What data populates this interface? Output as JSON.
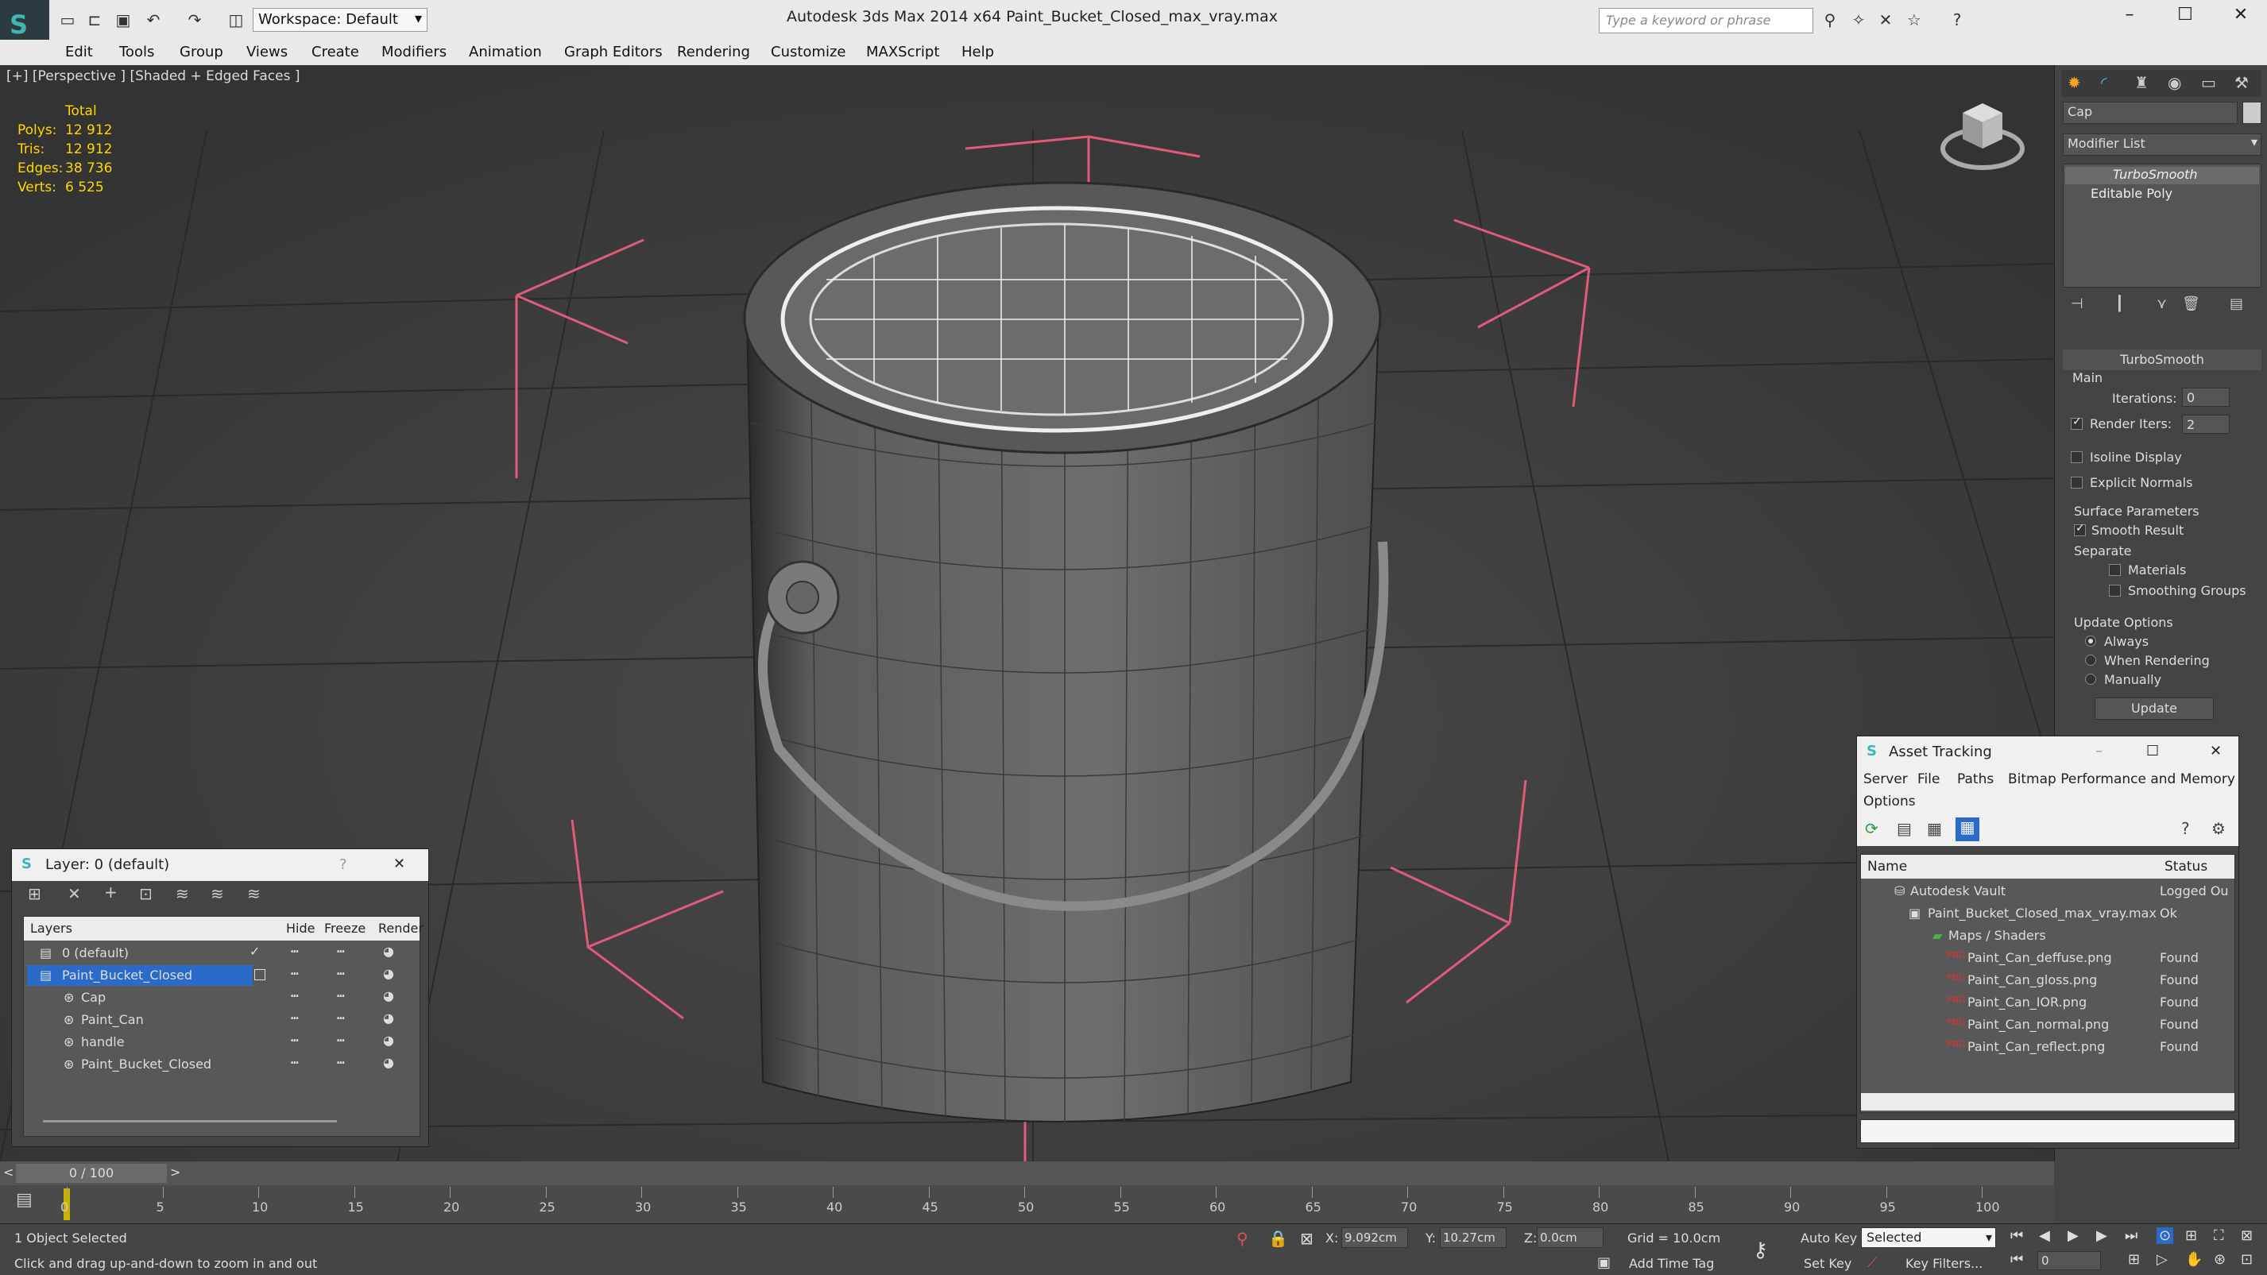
{
  "titlebar": {
    "workspace": "Workspace: Default",
    "title": "Autodesk 3ds Max  2014 x64      Paint_Bucket_Closed_max_vray.max",
    "search_placeholder": "Type a keyword or phrase"
  },
  "menu": [
    "Edit",
    "Tools",
    "Group",
    "Views",
    "Create",
    "Modifiers",
    "Animation",
    "Graph Editors",
    "Rendering",
    "Customize",
    "MAXScript",
    "Help"
  ],
  "viewport": {
    "label": "[+] [Perspective ] [Shaded + Edged Faces ]",
    "stats": {
      "header": "Total",
      "rows": [
        {
          "k": "Polys:",
          "v": "12 912"
        },
        {
          "k": "Tris:",
          "v": "12 912"
        },
        {
          "k": "Edges:",
          "v": "38 736"
        },
        {
          "k": "Verts:",
          "v": "6 525"
        }
      ]
    }
  },
  "command_panel": {
    "object_name": "Cap",
    "modifier_list": "Modifier List",
    "stack": [
      "TurboSmooth",
      "Editable Poly"
    ],
    "rollout_title": "TurboSmooth",
    "main_label": "Main",
    "iterations_label": "Iterations:",
    "iterations_value": "0",
    "render_iters_label": "Render Iters:",
    "render_iters_value": "2",
    "isoline": "Isoline Display",
    "explicit": "Explicit Normals",
    "surface_params": "Surface Parameters",
    "smooth_result": "Smooth Result",
    "separate": "Separate",
    "materials": "Materials",
    "smoothing_groups": "Smoothing Groups",
    "update_options": "Update Options",
    "always": "Always",
    "when_rendering": "When Rendering",
    "manually": "Manually",
    "update_btn": "Update"
  },
  "layer_window": {
    "title": "Layer: 0 (default)",
    "help": "?",
    "close": "✕",
    "columns": [
      "Layers",
      "Hide",
      "Freeze",
      "Render"
    ],
    "rows": [
      {
        "name": "0 (default)",
        "level": 0
      },
      {
        "name": "Paint_Bucket_Closed",
        "level": 0
      },
      {
        "name": "Cap",
        "level": 1
      },
      {
        "name": "Paint_Can",
        "level": 1
      },
      {
        "name": "handle",
        "level": 1
      },
      {
        "name": "Paint_Bucket_Closed",
        "level": 1
      }
    ]
  },
  "asset_window": {
    "title": "Asset Tracking",
    "menu": [
      "Server",
      "File",
      "Paths",
      "Bitmap Performance and Memory"
    ],
    "menu2": "Options",
    "columns": [
      "Name",
      "Status"
    ],
    "rows": [
      {
        "name": "Autodesk Vault",
        "status": "Logged Ou",
        "level": 0
      },
      {
        "name": "Paint_Bucket_Closed_max_vray.max",
        "status": "Ok",
        "level": 1
      },
      {
        "name": "Maps / Shaders",
        "status": "",
        "level": 2
      },
      {
        "name": "Paint_Can_deffuse.png",
        "status": "Found",
        "level": 3
      },
      {
        "name": "Paint_Can_gloss.png",
        "status": "Found",
        "level": 3
      },
      {
        "name": "Paint_Can_IOR.png",
        "status": "Found",
        "level": 3
      },
      {
        "name": "Paint_Can_normal.png",
        "status": "Found",
        "level": 3
      },
      {
        "name": "Paint_Can_reflect.png",
        "status": "Found",
        "level": 3
      }
    ]
  },
  "timeline": {
    "frame": "0 / 100",
    "ticks": [
      "0",
      "5",
      "10",
      "15",
      "20",
      "25",
      "30",
      "35",
      "40",
      "45",
      "50",
      "55",
      "60",
      "65",
      "70",
      "75",
      "80",
      "85",
      "90",
      "95",
      "100"
    ]
  },
  "status": {
    "selected": "1 Object Selected",
    "hint": "Click and drag up-and-down to zoom in and out",
    "x_label": "X:",
    "x": "9.092cm",
    "y_label": "Y:",
    "y": "10.27cm",
    "z_label": "Z:",
    "z": "0.0cm",
    "grid": "Grid = 10.0cm",
    "add_time_tag": "Add Time Tag",
    "auto_key": "Auto Key",
    "set_key": "Set Key",
    "selected_dropdown": "Selected",
    "key_filters": "Key Filters...",
    "frame_field": "0"
  },
  "colors": {
    "accent": "#3fb6b0",
    "stats": "#ffd700",
    "gizmo": "#e05a7a",
    "select": "#2a6ac8"
  }
}
